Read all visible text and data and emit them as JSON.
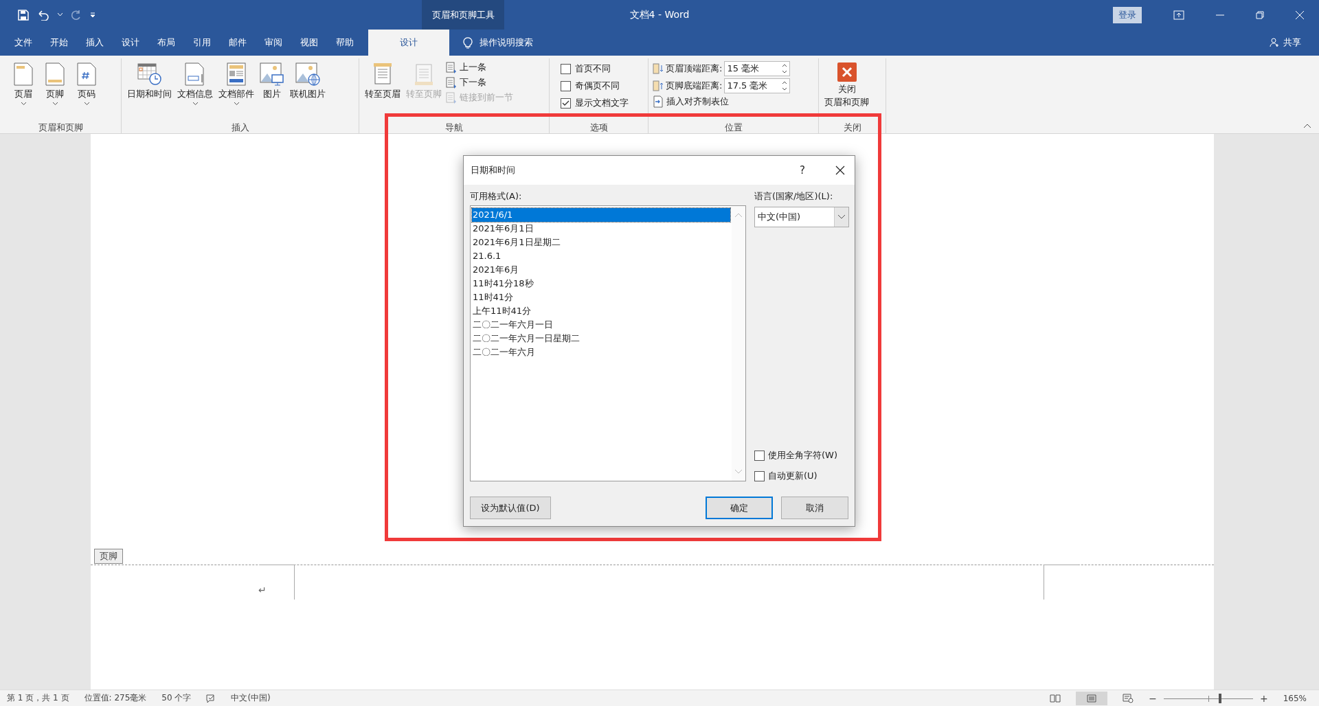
{
  "title_bar": {
    "context_tools": "页眉和页脚工具",
    "title": "文档4  -  Word",
    "login": "登录"
  },
  "tabs": [
    {
      "label": "文件",
      "selected": false
    },
    {
      "label": "开始",
      "selected": false
    },
    {
      "label": "插入",
      "selected": false
    },
    {
      "label": "设计",
      "selected": false
    },
    {
      "label": "布局",
      "selected": false
    },
    {
      "label": "引用",
      "selected": false
    },
    {
      "label": "邮件",
      "selected": false
    },
    {
      "label": "审阅",
      "selected": false
    },
    {
      "label": "视图",
      "selected": false
    },
    {
      "label": "帮助",
      "selected": false
    },
    {
      "label": "设计",
      "selected": true
    }
  ],
  "tell_me": "操作说明搜索",
  "share": "共享",
  "ribbon": {
    "header_footer": {
      "label": "页眉和页脚",
      "buttons": [
        {
          "label": "页眉",
          "dropdown": true
        },
        {
          "label": "页脚",
          "dropdown": true
        },
        {
          "label": "页码",
          "dropdown": true
        }
      ]
    },
    "insert": {
      "label": "插入",
      "buttons": [
        {
          "label": "日期和时间",
          "dropdown": false
        },
        {
          "label": "文档信息",
          "dropdown": true
        },
        {
          "label": "文档部件",
          "dropdown": true
        },
        {
          "label": "图片",
          "dropdown": false
        },
        {
          "label": "联机图片",
          "dropdown": false
        }
      ]
    },
    "navigation": {
      "label": "导航",
      "large": [
        {
          "label": "转至页眉",
          "disabled": false
        },
        {
          "label": "转至页脚",
          "disabled": true
        }
      ],
      "small": [
        {
          "label": "上一条",
          "disabled": false
        },
        {
          "label": "下一条",
          "disabled": false
        },
        {
          "label": "链接到前一节",
          "disabled": true
        }
      ]
    },
    "options": {
      "label": "选项",
      "checkboxes": [
        {
          "label": "首页不同",
          "checked": false
        },
        {
          "label": "奇偶页不同",
          "checked": false
        },
        {
          "label": "显示文档文字",
          "checked": true
        }
      ]
    },
    "position": {
      "label": "位置",
      "spinners": [
        {
          "label": "页眉顶端距离:",
          "value": "15 毫米"
        },
        {
          "label": "页脚底端距离:",
          "value": "17.5 毫米"
        }
      ],
      "insert_tab": "插入对齐制表位"
    },
    "close": {
      "label": "关闭",
      "button_lines": [
        "关闭",
        "页眉和页脚"
      ]
    }
  },
  "document": {
    "footer_tag": "页脚",
    "paragraph_mark": "↵"
  },
  "dialog": {
    "title": "日期和时间",
    "help": "?",
    "formats_label": "可用格式(A):",
    "formats": [
      {
        "text": "2021/6/1",
        "selected": true
      },
      {
        "text": "2021年6月1日",
        "selected": false
      },
      {
        "text": "2021年6月1日星期二",
        "selected": false
      },
      {
        "text": "21.6.1",
        "selected": false
      },
      {
        "text": "2021年6月",
        "selected": false
      },
      {
        "text": "11时41分18秒",
        "selected": false
      },
      {
        "text": "11时41分",
        "selected": false
      },
      {
        "text": "上午11时41分",
        "selected": false
      },
      {
        "text": "二〇二一年六月一日",
        "selected": false
      },
      {
        "text": "二〇二一年六月一日星期二",
        "selected": false
      },
      {
        "text": "二〇二一年六月",
        "selected": false
      }
    ],
    "language_label": "语言(国家/地区)(L):",
    "language": "中文(中国)",
    "checkboxes": [
      {
        "label": "使用全角字符(W)",
        "checked": false
      },
      {
        "label": "自动更新(U)",
        "checked": false
      }
    ],
    "buttons": [
      {
        "label": "设为默认值(D)",
        "default": false
      },
      {
        "label": "确定",
        "default": true
      },
      {
        "label": "取消",
        "default": false
      }
    ]
  },
  "status_bar": {
    "page": "第 1 页，共 1 页",
    "position": "位置值: 275毫米",
    "words": "50 个字",
    "language": "中文(中国)",
    "zoom": {
      "level": 0.63,
      "minus": "−",
      "plus": "+",
      "percent": "165%"
    }
  }
}
